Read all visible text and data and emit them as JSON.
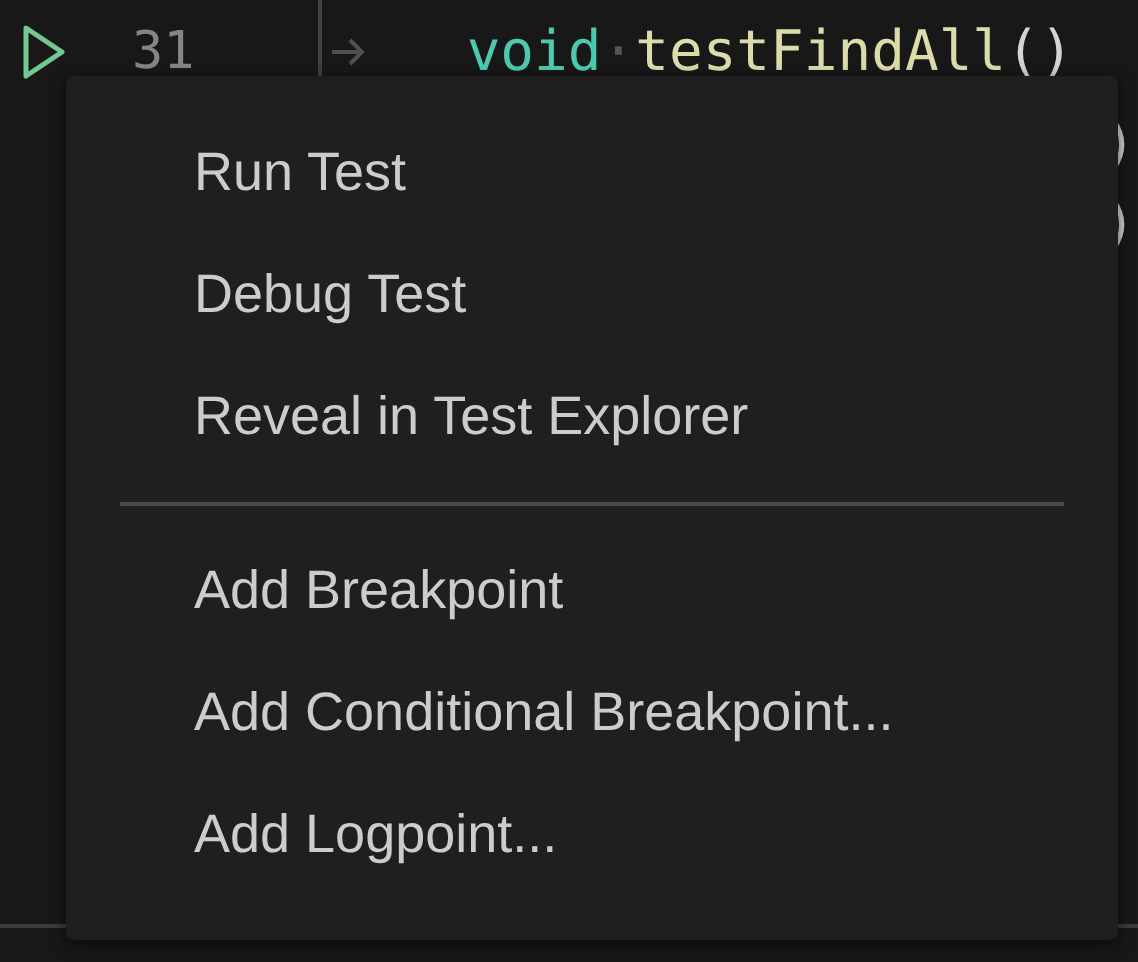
{
  "editor": {
    "line_number": "31",
    "keyword": "void",
    "whitespace_mark": "·",
    "function_name": "testFindAll",
    "parens": "()",
    "hidden_line_ends": [
      ")",
      ")"
    ]
  },
  "context_menu": {
    "groups": [
      {
        "items": [
          {
            "label": "Run Test"
          },
          {
            "label": "Debug Test"
          },
          {
            "label": "Reveal in Test Explorer"
          }
        ]
      },
      {
        "items": [
          {
            "label": "Add Breakpoint"
          },
          {
            "label": "Add Conditional Breakpoint..."
          },
          {
            "label": "Add Logpoint..."
          }
        ]
      }
    ]
  }
}
